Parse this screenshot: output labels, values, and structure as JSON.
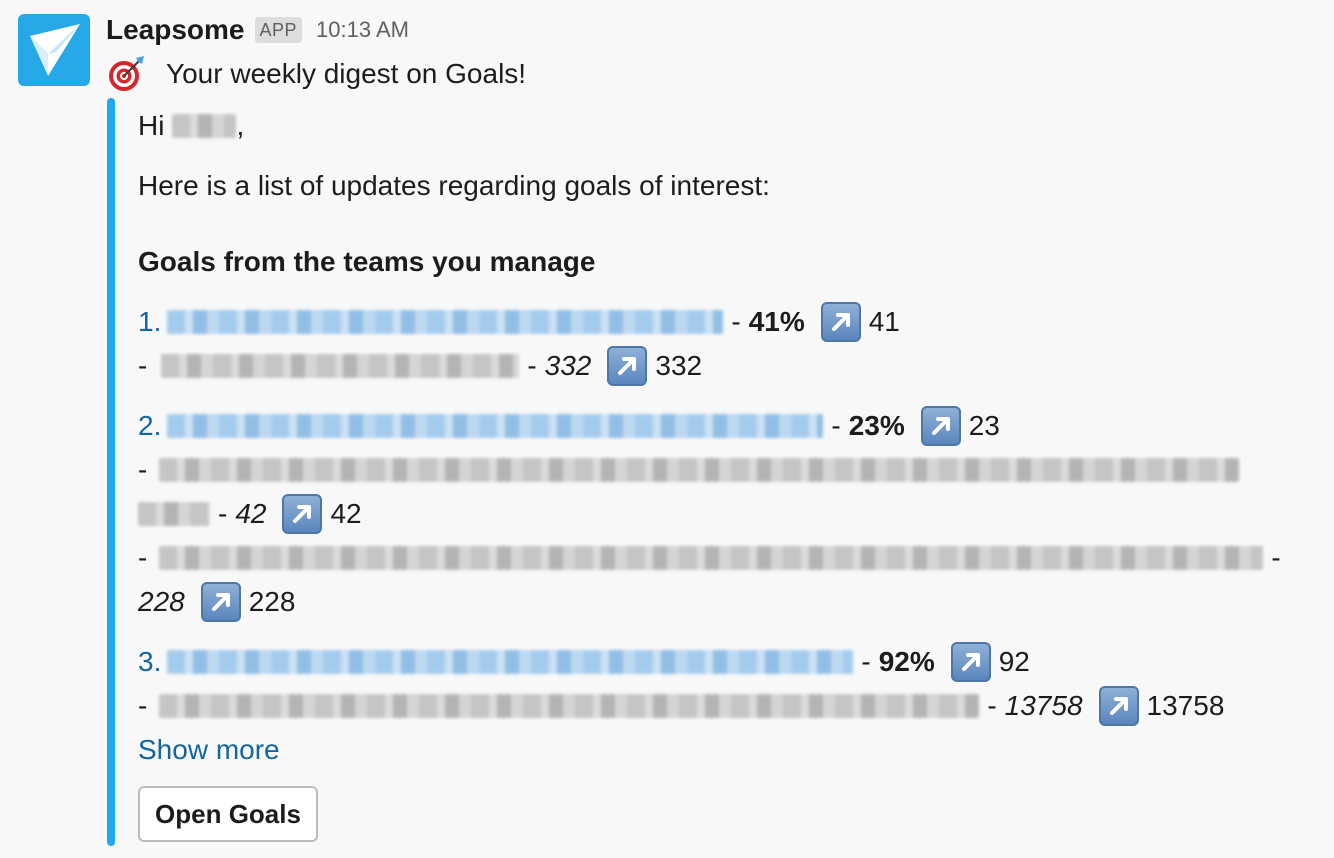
{
  "message": {
    "sender": "Leapsome",
    "badge": "APP",
    "time": "10:13 AM",
    "title": "Your weekly digest on Goals!"
  },
  "content": {
    "greeting": "Hi",
    "greeting_suffix": ",",
    "intro": "Here is a list of updates regarding goals of interest:",
    "section_title": "Goals from the teams you manage",
    "goals": [
      {
        "number": "1.",
        "percent": "41%",
        "change": "41",
        "key_results": [
          {
            "value": "332",
            "change": "332"
          }
        ]
      },
      {
        "number": "2.",
        "percent": "23%",
        "change": "23",
        "key_results": [
          {
            "value": "42",
            "change": "42"
          },
          {
            "value": "228",
            "change": "228"
          }
        ]
      },
      {
        "number": "3.",
        "percent": "92%",
        "change": "92",
        "key_results": [
          {
            "value": "13758",
            "change": "13758"
          }
        ]
      }
    ],
    "dash": "-",
    "show_more": "Show more",
    "open_button": "Open Goals"
  },
  "colors": {
    "accent_bar": "#1ea8ef",
    "link": "#1264a3",
    "avatar_bg": "#27a8e8"
  }
}
